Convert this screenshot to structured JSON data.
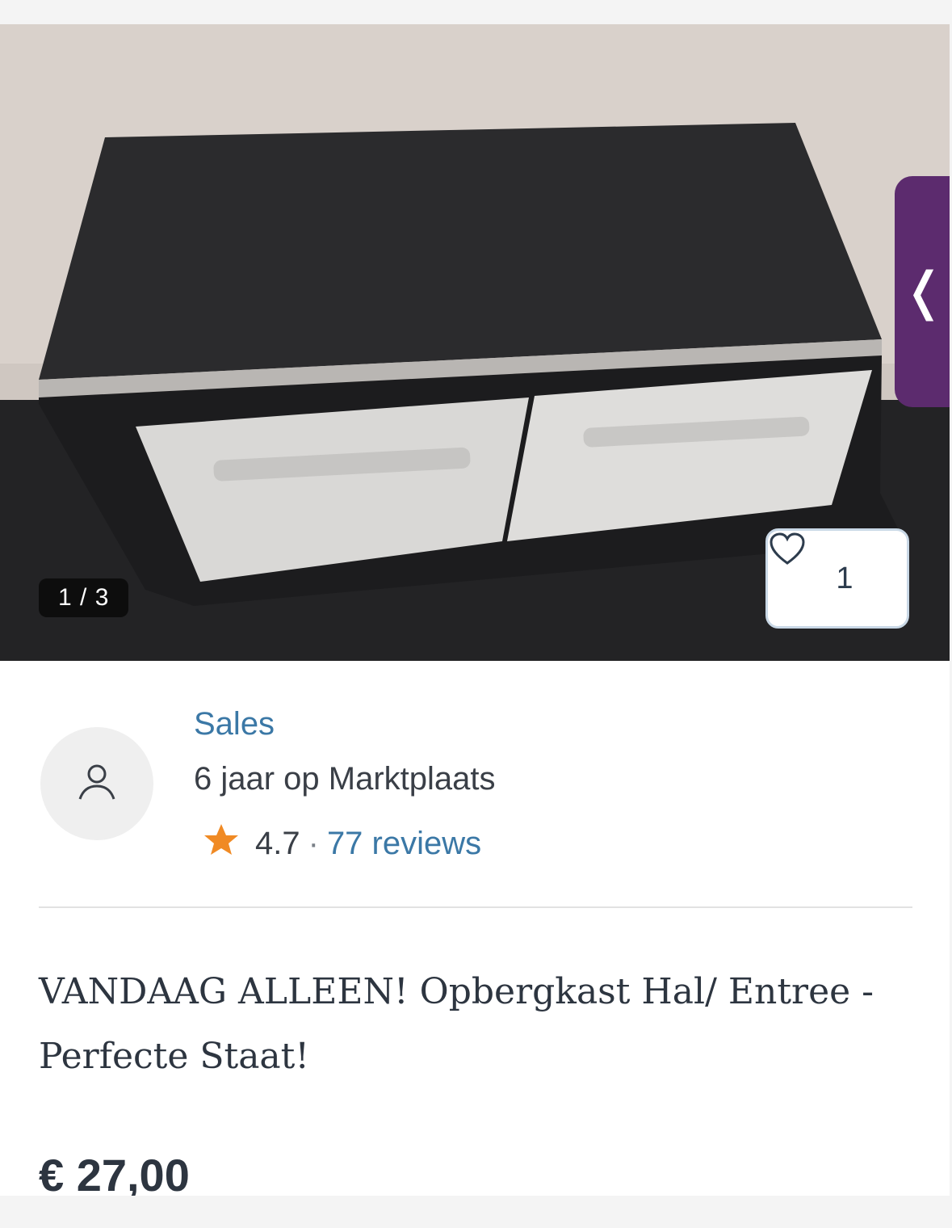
{
  "gallery": {
    "counter": "1 / 3",
    "favorite_count": "1",
    "prev_icon": "chevron-left-icon"
  },
  "seller": {
    "name": "Sales",
    "member_since": "6 jaar op Marktplaats",
    "rating": "4.7",
    "separator": "·",
    "reviews": "77 reviews",
    "star_color": "#f08a24"
  },
  "listing": {
    "title": "VANDAAG ALLEEN! Opbergkast Hal/ Entree - Perfecte Staat!",
    "price": "€ 27,00"
  },
  "colors": {
    "link": "#3b78a6",
    "text": "#2d3540",
    "accent_tab": "#5c2b6e"
  }
}
